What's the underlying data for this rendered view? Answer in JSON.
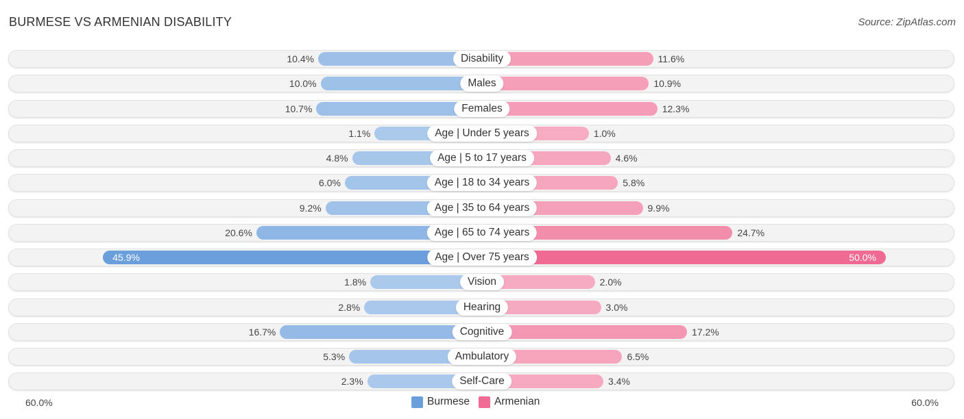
{
  "title": "BURMESE VS ARMENIAN DISABILITY",
  "source": "Source: ZipAtlas.com",
  "chart_data": {
    "type": "bar",
    "orientation": "horizontal-diverging",
    "title": "BURMESE VS ARMENIAN DISABILITY",
    "categories": [
      "Disability",
      "Males",
      "Females",
      "Age | Under 5 years",
      "Age | 5 to 17 years",
      "Age | 18 to 34 years",
      "Age | 35 to 64 years",
      "Age | 65 to 74 years",
      "Age | Over 75 years",
      "Vision",
      "Hearing",
      "Cognitive",
      "Ambulatory",
      "Self-Care"
    ],
    "series": [
      {
        "name": "Burmese",
        "color": "#6a9fdc",
        "values": [
          10.4,
          10.0,
          10.7,
          1.1,
          4.8,
          6.0,
          9.2,
          20.6,
          45.9,
          1.8,
          2.8,
          16.7,
          5.3,
          2.3
        ]
      },
      {
        "name": "Armenian",
        "color": "#f06b93",
        "values": [
          11.6,
          10.9,
          12.3,
          1.0,
          4.6,
          5.8,
          9.9,
          24.7,
          50.0,
          2.0,
          3.0,
          17.2,
          6.5,
          3.4
        ]
      }
    ],
    "value_labels": {
      "Burmese": [
        "10.4%",
        "10.0%",
        "10.7%",
        "1.1%",
        "4.8%",
        "6.0%",
        "9.2%",
        "20.6%",
        "45.9%",
        "1.8%",
        "2.8%",
        "16.7%",
        "5.3%",
        "2.3%"
      ],
      "Armenian": [
        "11.6%",
        "10.9%",
        "12.3%",
        "1.0%",
        "4.6%",
        "5.8%",
        "9.9%",
        "24.7%",
        "50.0%",
        "2.0%",
        "3.0%",
        "17.2%",
        "6.5%",
        "3.4%"
      ]
    },
    "xlim": [
      -60,
      60
    ],
    "axis_labels": {
      "left": "60.0%",
      "right": "60.0%"
    },
    "legend": {
      "position": "bottom-center",
      "entries": [
        "Burmese",
        "Armenian"
      ]
    },
    "grid": false
  }
}
